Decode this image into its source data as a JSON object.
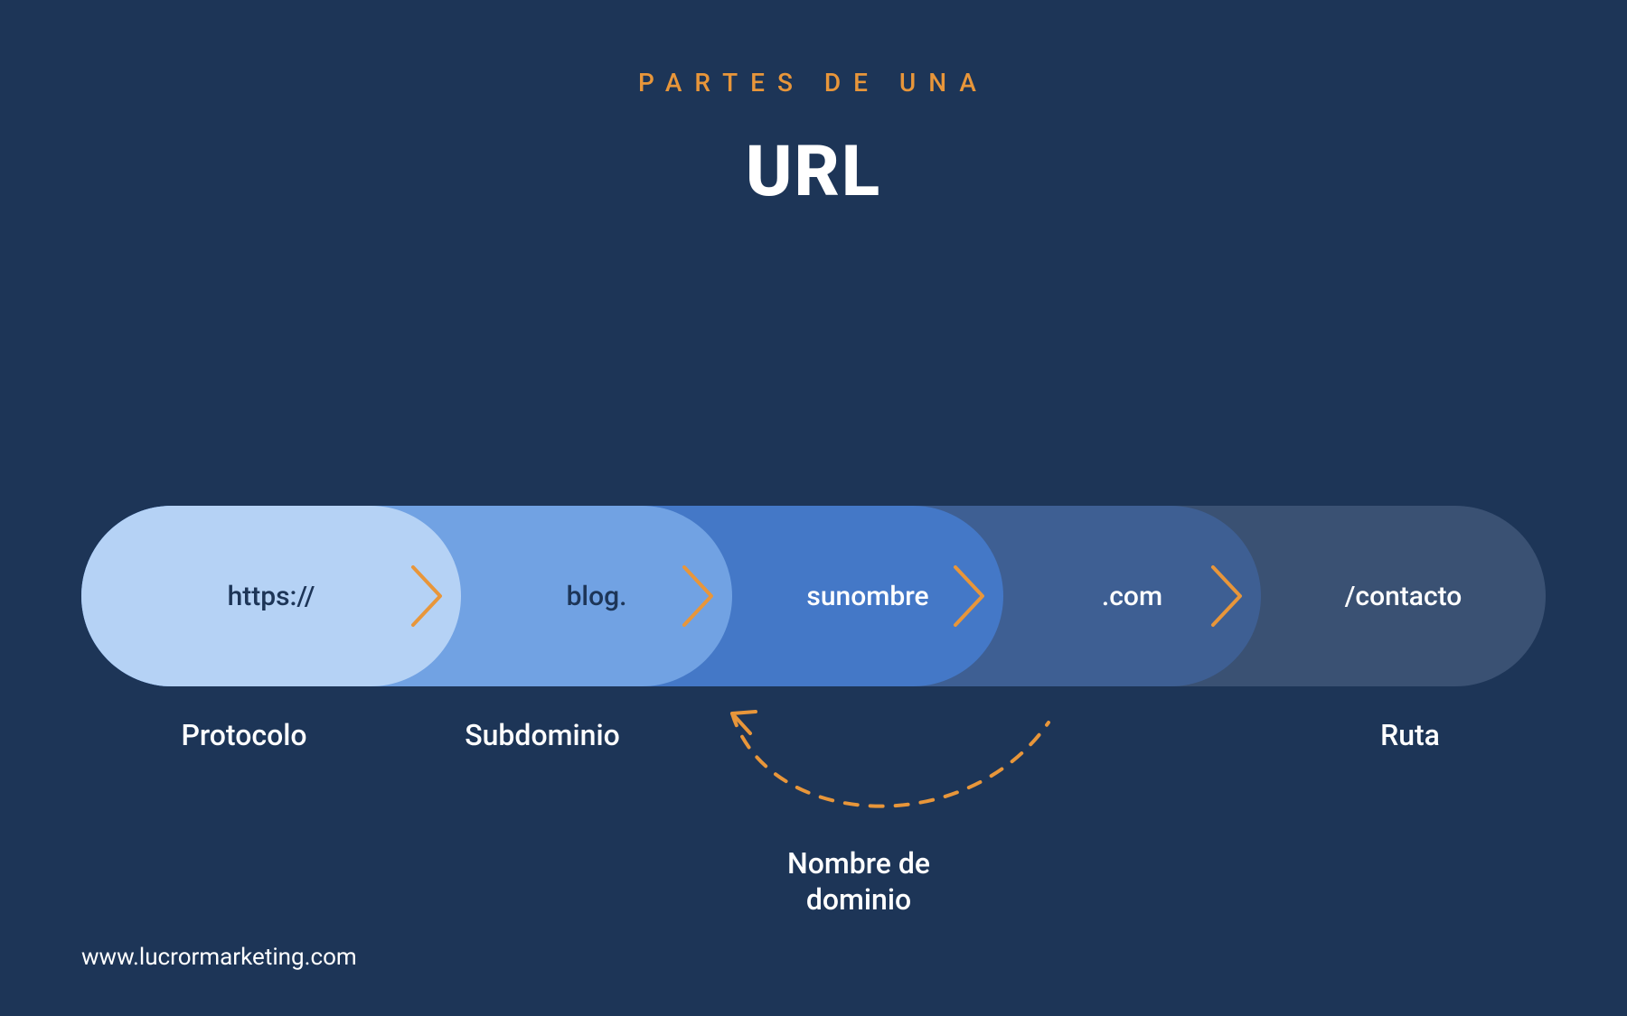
{
  "header": {
    "subtitle": "PARTES DE UNA",
    "title": "URL"
  },
  "parts": [
    {
      "text": "https://",
      "label": "Protocolo",
      "color": "#b5d2f5"
    },
    {
      "text": "blog.",
      "label": "Subdominio",
      "color": "#71a2e3"
    },
    {
      "text": "sunombre",
      "label": "",
      "color": "#4478c7"
    },
    {
      "text": ".com",
      "label": "",
      "color": "#3e5f93"
    },
    {
      "text": "/contacto",
      "label": "Ruta",
      "color": "#3a5173"
    }
  ],
  "domain_label": "Nombre de dominio",
  "accent_color": "#e8963a",
  "footer": "www.lucrormarketing.com"
}
